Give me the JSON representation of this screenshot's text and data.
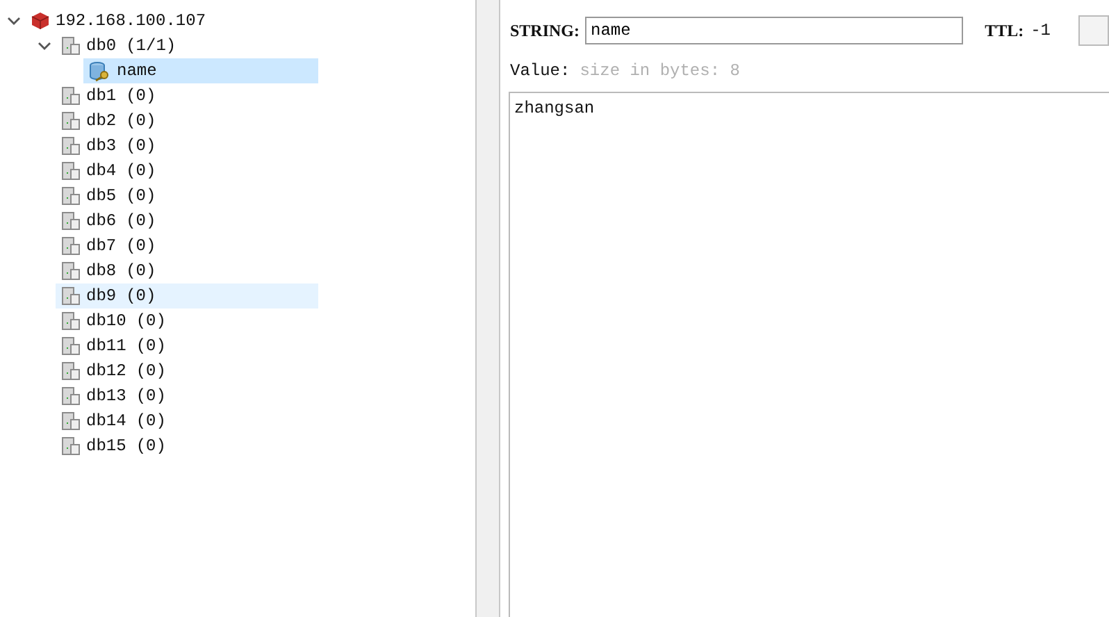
{
  "server": {
    "label": "192.168.100.107",
    "expanded": true,
    "children": [
      {
        "label": "db0",
        "count": "(1/1)",
        "expanded": true,
        "selected": false,
        "hovered": false,
        "children": [
          {
            "label": "name",
            "selected": true
          }
        ]
      },
      {
        "label": "db1",
        "count": "(0)",
        "selected": false,
        "hovered": false
      },
      {
        "label": "db2",
        "count": "(0)",
        "selected": false,
        "hovered": false
      },
      {
        "label": "db3",
        "count": "(0)",
        "selected": false,
        "hovered": false
      },
      {
        "label": "db4",
        "count": "(0)",
        "selected": false,
        "hovered": false
      },
      {
        "label": "db5",
        "count": "(0)",
        "selected": false,
        "hovered": false
      },
      {
        "label": "db6",
        "count": "(0)",
        "selected": false,
        "hovered": false
      },
      {
        "label": "db7",
        "count": "(0)",
        "selected": false,
        "hovered": false
      },
      {
        "label": "db8",
        "count": "(0)",
        "selected": false,
        "hovered": false
      },
      {
        "label": "db9",
        "count": "(0)",
        "selected": false,
        "hovered": true
      },
      {
        "label": "db10",
        "count": "(0)",
        "selected": false,
        "hovered": false
      },
      {
        "label": "db11",
        "count": "(0)",
        "selected": false,
        "hovered": false
      },
      {
        "label": "db12",
        "count": "(0)",
        "selected": false,
        "hovered": false
      },
      {
        "label": "db13",
        "count": "(0)",
        "selected": false,
        "hovered": false
      },
      {
        "label": "db14",
        "count": "(0)",
        "selected": false,
        "hovered": false
      },
      {
        "label": "db15",
        "count": "(0)",
        "selected": false,
        "hovered": false
      }
    ]
  },
  "editor": {
    "type_label": "STRING:",
    "key": "name",
    "ttl_label": "TTL:",
    "ttl": "-1",
    "value_label": "Value:",
    "value_hint": "size in bytes: 8",
    "value": "zhangsan"
  }
}
